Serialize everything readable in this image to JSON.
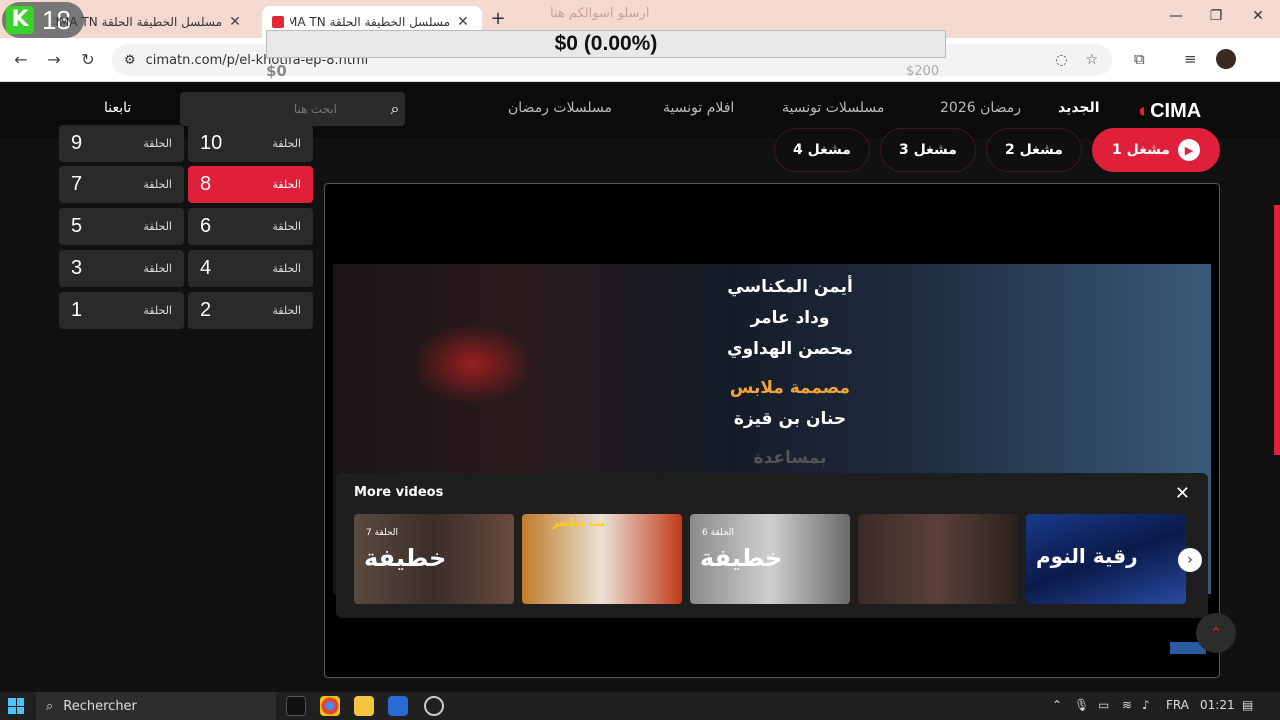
{
  "browser": {
    "tabs": [
      {
        "title": "مسلسل الخطيفة الحلقة CIMA TN"
      },
      {
        "title": "مسلسل الخطيفة الحلقة CIMA TN"
      }
    ],
    "ghost_text": "ارسلو اسوالكم هنا",
    "url": "cimatn.com/p/el-khotifa-ep-8.html",
    "overlay_amount": "$0 (0.00%)",
    "overlay_left": "$0",
    "overlay_right": "$200",
    "badge_number": "18"
  },
  "site": {
    "logo": "CIMA",
    "nav": [
      {
        "label": "الجديد",
        "active": true
      },
      {
        "label": "رمضان 2026"
      },
      {
        "label": "مسلسلات تونسية"
      },
      {
        "label": "افلام تونسية"
      },
      {
        "label": "مسلسلات رمضان"
      }
    ],
    "search_placeholder": "ابحث هنا",
    "follow": "تابعنا"
  },
  "episodes": {
    "label": "الحلقة",
    "items": [
      {
        "n": "10"
      },
      {
        "n": "9"
      },
      {
        "n": "8",
        "active": true
      },
      {
        "n": "7"
      },
      {
        "n": "6"
      },
      {
        "n": "5"
      },
      {
        "n": "4"
      },
      {
        "n": "3"
      },
      {
        "n": "2"
      },
      {
        "n": "1"
      }
    ]
  },
  "servers": [
    {
      "label": "مشغل 1",
      "active": true
    },
    {
      "label": "مشغل 2"
    },
    {
      "label": "مشغل 3"
    },
    {
      "label": "مشغل 4"
    }
  ],
  "player": {
    "credits": [
      "أيمن المكناسي",
      "وداد عامر",
      "محصن الهداوي",
      "مصممة ملابس",
      "حنان بن قيزة",
      "بمساعدة"
    ],
    "more_videos": {
      "title": "More videos",
      "thumbs": [
        {
          "caption": "خطيفة",
          "ep": "الحلقة 7"
        },
        {
          "caption": "بث مباشر"
        },
        {
          "caption": "خطيفة",
          "ep": "الحلقة 6"
        },
        {
          "caption": ""
        },
        {
          "caption": "رقية النوم"
        }
      ]
    }
  },
  "taskbar": {
    "search": "Rechercher",
    "lang": "FRA",
    "time": "01:21"
  }
}
